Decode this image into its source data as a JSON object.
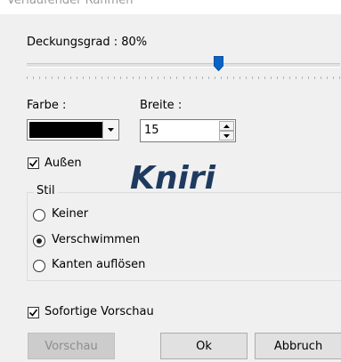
{
  "window": {
    "title": "Verlaufender Rahmen"
  },
  "opacity": {
    "label": "Deckungsgrad : 80%",
    "value_percent": 80
  },
  "color": {
    "label": "Farbe :",
    "value_hex": "#000000",
    "icon": "dropdown-arrow-icon"
  },
  "width": {
    "label": "Breite :",
    "value": "15",
    "icons": [
      "spin-up-icon",
      "spin-down-icon"
    ]
  },
  "outside": {
    "label": "Außen",
    "checked": true
  },
  "style_group": {
    "legend": "Stil",
    "options": [
      {
        "label": "Keiner",
        "selected": false
      },
      {
        "label": "Verschwimmen",
        "selected": true
      },
      {
        "label": "Kanten auflösen",
        "selected": false
      }
    ]
  },
  "preview_option": {
    "label": "Sofortige Vorschau",
    "checked": true
  },
  "buttons": {
    "preview": "Vorschau",
    "ok": "Ok",
    "cancel": "Abbruch"
  },
  "watermark": "Kniri"
}
